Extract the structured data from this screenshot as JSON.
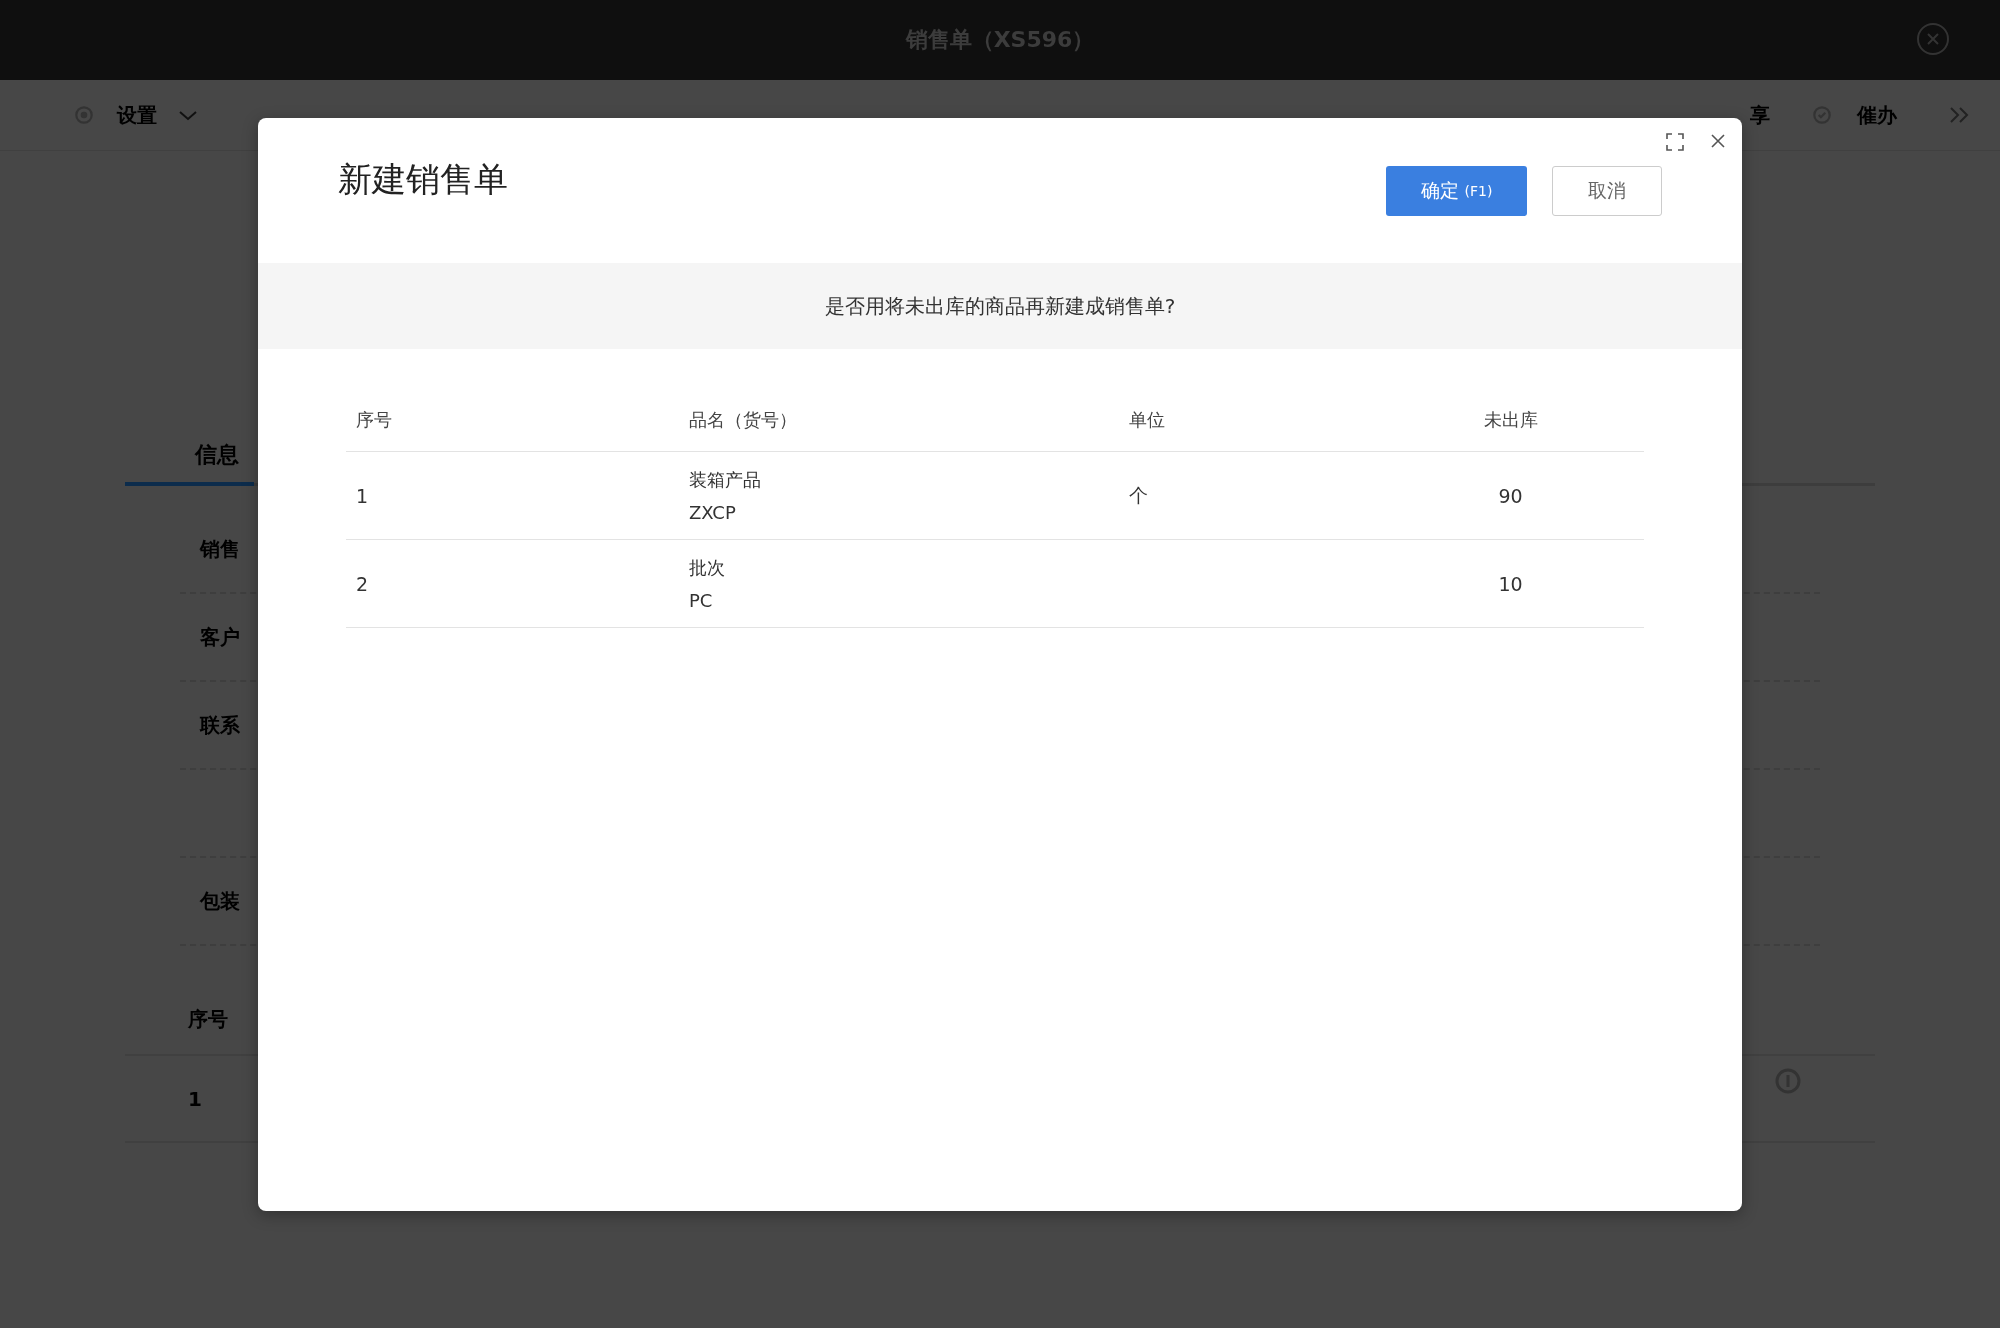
{
  "window": {
    "title": "销售单（XS596）"
  },
  "toolbar": [
    {
      "label": "设置",
      "dropdown": true
    },
    {
      "label": "享",
      "dropdown": false
    },
    {
      "label": "催办",
      "dropdown": false
    }
  ],
  "tabs": [
    {
      "label": "信息",
      "selected": true
    }
  ],
  "form_rows": [
    {
      "label": "销售"
    },
    {
      "label": "客户"
    },
    {
      "label": "联系"
    },
    {
      "kind": "blank"
    },
    {
      "label": "包装"
    }
  ],
  "items_table": {
    "columns": [
      "序号"
    ],
    "rows": [
      [
        "1"
      ]
    ]
  },
  "dialog": {
    "title": "新建销售单",
    "confirm_button": "确定",
    "confirm_shortcut": "(F1)",
    "cancel_button": "取消",
    "prompt": "是否用将未出库的商品再新建成销售单?",
    "columns": [
      "序号",
      "品名（货号）",
      "单位",
      "未出库"
    ],
    "rows": [
      {
        "index": "1",
        "name": "装箱产品",
        "code": "ZXCP",
        "unit": "个",
        "quantity": "90"
      },
      {
        "index": "2",
        "name": "批次",
        "code": "PC",
        "quantity": "10"
      }
    ]
  }
}
